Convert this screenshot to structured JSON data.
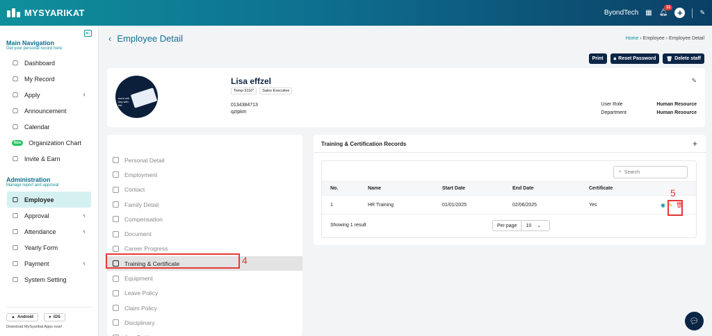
{
  "app": {
    "brand": "MYSYARIKAT"
  },
  "topbar": {
    "company": "ByondTech",
    "notif_count": "11"
  },
  "sidebar": {
    "main_title": "Main Navigation",
    "main_sub": "Get your personal record here",
    "main_items": [
      {
        "label": "Dashboard",
        "icon": "dashboard-icon"
      },
      {
        "label": "My Record",
        "icon": "folder-icon"
      },
      {
        "label": "Apply",
        "icon": "apply-icon",
        "chevron": true
      },
      {
        "label": "Announcement",
        "icon": "announcement-icon"
      },
      {
        "label": "Calendar",
        "icon": "calendar-icon"
      },
      {
        "label": "Organization Chart",
        "icon": "new-badge"
      },
      {
        "label": "Invite & Earn",
        "icon": "gift-icon"
      }
    ],
    "new_badge": "New",
    "admin_title": "Administration",
    "admin_sub": "Manage report and approval",
    "admin_items": [
      {
        "label": "Employee",
        "active": true
      },
      {
        "label": "Approval",
        "chevron": true
      },
      {
        "label": "Attendance",
        "chevron": true
      },
      {
        "label": "Yearly Form"
      },
      {
        "label": "Payment",
        "chevron": true
      },
      {
        "label": "System Setting"
      }
    ],
    "android": "Android",
    "ios": "iOS",
    "download_text": "Download MySyarikat Apps now!"
  },
  "page": {
    "title": "Employee Detail",
    "breadcrumb": [
      "Home",
      "Employee",
      "Employee Detail"
    ],
    "buttons": {
      "print": "Print",
      "reset": "Reset Password",
      "delete": "Delete staff"
    }
  },
  "profile": {
    "name": "Lisa effzel",
    "tag_id": "Temp-3116*",
    "tag_role": "Sales Executive",
    "phone": "0134384713",
    "extra": "qztpkm",
    "role_label": "User Role",
    "role_value": "Human Resource",
    "dept_label": "Department",
    "dept_value": "Human Resource",
    "avatar_text": "ment will\nday with\nrkit."
  },
  "submenu": [
    "Personal Detail",
    "Employment",
    "Contact",
    "Family Detail",
    "Compensation",
    "Document",
    "Career Progress",
    "Training & Certificate",
    "Equipment",
    "Leave Policy",
    "Claim Policy",
    "Disciplinary",
    "App Setting"
  ],
  "submenu_active": 7,
  "annotations": {
    "n4": "4",
    "n5": "5"
  },
  "panel": {
    "title": "Training & Certification Records",
    "search_placeholder": "Search",
    "headers": [
      "No.",
      "Name",
      "Start Date",
      "End Date",
      "Certificate"
    ],
    "rows": [
      {
        "no": "1",
        "name": "HR Training",
        "start": "01/01/2025",
        "end": "02/06/2025",
        "cert": "Yes"
      }
    ],
    "showing": "Showing 1 result",
    "per_page_label": "Per page",
    "per_page_value": "10"
  }
}
